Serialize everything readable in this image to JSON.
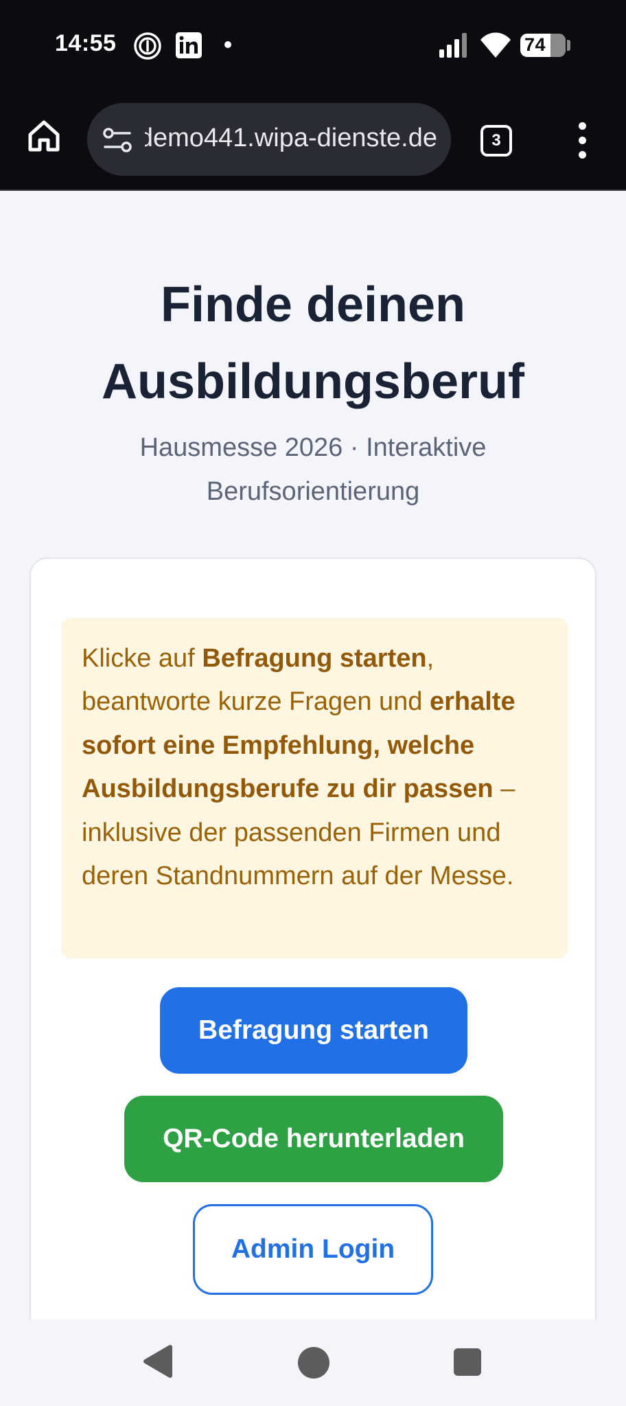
{
  "status_bar": {
    "time": "14:55",
    "battery_level": "74",
    "icons": [
      "fingerprint-icon",
      "linkedin-icon",
      "notification-dot-icon",
      "signal-icon",
      "wifi-icon",
      "battery-icon"
    ]
  },
  "browser": {
    "url": "demo441.wipa-dienste.de",
    "tab_count": "3",
    "icons": [
      "home-icon",
      "site-settings-icon",
      "tabs-icon",
      "more-vert-icon"
    ]
  },
  "page": {
    "title": "Finde deinen Ausbildungsberuf",
    "subtitle": "Hausmesse 2026 · Interaktive Berufsorientierung"
  },
  "info": {
    "part1": "Klicke auf ",
    "bold1": "Befragung starten",
    "part2": ", beantworte kurze Fragen und ",
    "bold2": "erhalte sofort eine Empfehlung, welche Ausbildungsberufe zu dir passen",
    "part3": " – inklusive der passenden Firmen und deren Standnummern auf der Messe."
  },
  "buttons": {
    "start": "Befragung starten",
    "qr": "QR-Code herunterladen",
    "admin": "Admin Login"
  },
  "colors": {
    "primary_blue": "#2170e6",
    "success_green": "#2fa145",
    "info_bg": "#fef6e0",
    "info_text": "#9a6206",
    "title_text": "#1a2236"
  }
}
